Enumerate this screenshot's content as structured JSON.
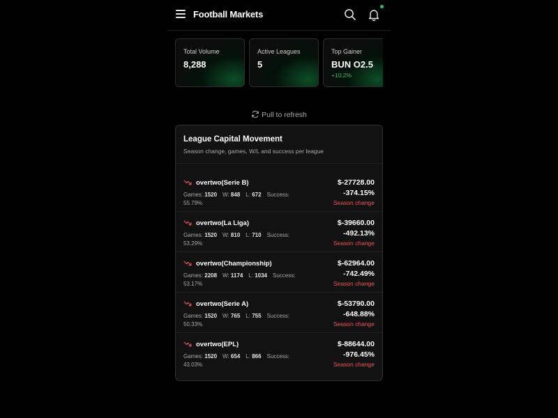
{
  "header": {
    "title": "Football Markets",
    "icons": [
      "menu-icon",
      "search-icon",
      "bell-icon"
    ],
    "notification_dot_color": "#22c55e"
  },
  "stats": [
    {
      "label": "Total Volume",
      "value": "8,288",
      "change": ""
    },
    {
      "label": "Active Leagues",
      "value": "5",
      "change": ""
    },
    {
      "label": "Top Gainer",
      "value": "BUN O2.5",
      "change": "+10.2%"
    }
  ],
  "refresh": {
    "label": "Pull to refresh"
  },
  "panel": {
    "title": "League Capital Movement",
    "subtitle": "Season change, games, W/L and success per league",
    "labels": {
      "games": "Games:",
      "wins": "W:",
      "losses": "L:",
      "success": "Success:",
      "season_change": "Season change"
    },
    "leagues": [
      {
        "name": "overtwo(Serie B)",
        "games": "1520",
        "wins": "848",
        "losses": "672",
        "success": "55.79%",
        "amount": "$-27728.00",
        "pct": "-374.15%"
      },
      {
        "name": "overtwo(La Liga)",
        "games": "1520",
        "wins": "810",
        "losses": "710",
        "success": "53.29%",
        "amount": "$-39660.00",
        "pct": "-492.13%"
      },
      {
        "name": "overtwo(Championship)",
        "games": "2208",
        "wins": "1174",
        "losses": "1034",
        "success": "53.17%",
        "amount": "$-62964.00",
        "pct": "-742.49%"
      },
      {
        "name": "overtwo(Serie A)",
        "games": "1520",
        "wins": "765",
        "losses": "755",
        "success": "50.33%",
        "amount": "$-53790.00",
        "pct": "-648.88%"
      },
      {
        "name": "overtwo(EPL)",
        "games": "1520",
        "wins": "654",
        "losses": "866",
        "success": "43.03%",
        "amount": "$-88644.00",
        "pct": "-976.45%"
      }
    ]
  },
  "colors": {
    "accent": "#22c55e",
    "negative": "#ef5350",
    "background": "#000000"
  }
}
